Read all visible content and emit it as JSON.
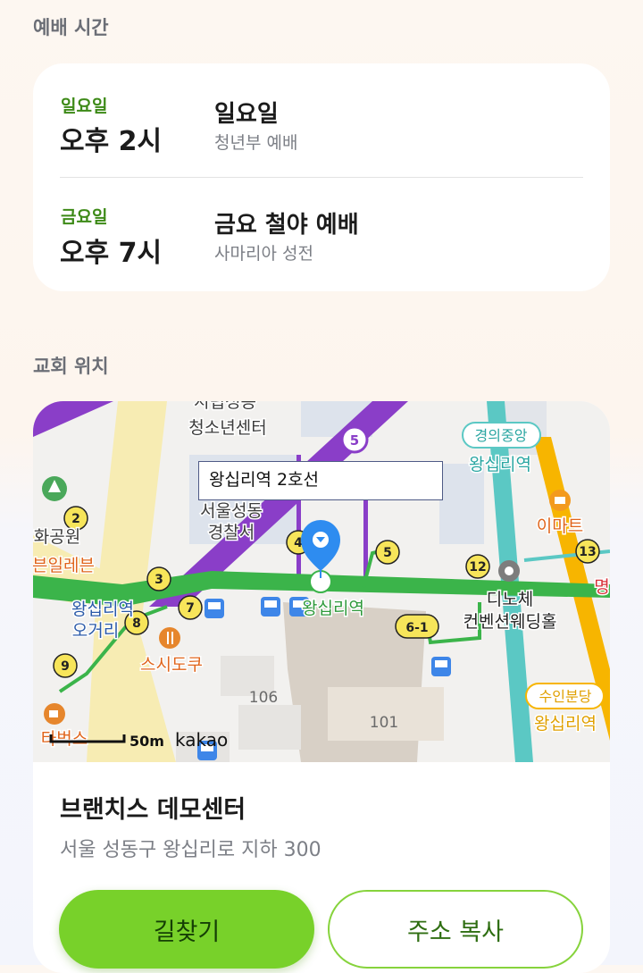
{
  "worship": {
    "section_title": "예배 시간",
    "services": [
      {
        "day": "일요일",
        "time": "오후 2시",
        "name": "일요일",
        "place": "청년부 예배"
      },
      {
        "day": "금요일",
        "time": "오후 7시",
        "name": "금요 철야 예배",
        "place": "사마리아 성전"
      }
    ]
  },
  "location": {
    "section_title": "교회 위치",
    "map": {
      "tooltip": "왕십리역 2호선",
      "labels": {
        "youth_center_1": "시립성동",
        "youth_center_2": "청소년센터",
        "police_1": "서울성동",
        "police_2": "경찰서",
        "gyeongui_badge": "경의중앙",
        "gyeongui_station": "왕십리역",
        "emart": "이마트",
        "park": "화공원",
        "seven_eleven": "븐일레븐",
        "exit_1": "왕십리역",
        "exit_2": "오거리",
        "sushi": "스시도쿠",
        "station_main": "왕십리역",
        "dino_1": "디노체",
        "dino_2": "컨벤션웨딩홀",
        "myeong": "명",
        "suin_badge": "수인분당",
        "suin_station": "왕십리역",
        "bldg_106": "106",
        "bldg_101": "101",
        "starbucks": "타벅스",
        "scale": "50m",
        "brand": "kakao"
      },
      "exits": [
        "2",
        "3",
        "4",
        "5",
        "6-1",
        "7",
        "8",
        "9",
        "12",
        "13"
      ],
      "line5_badge": "5"
    },
    "place_name": "브랜치스 데모센터",
    "address": "서울 성동구 왕십리로 지하 300",
    "directions_button": "길찾기",
    "copy_button": "주소 복사"
  },
  "colors": {
    "accent_green": "#78d12a",
    "line2_green": "#3bb44a",
    "line5_purple": "#8a3ec8",
    "suin_yellow": "#f7b500",
    "gyeongui_teal": "#5bc8c4",
    "marker_blue": "#2e8cf0"
  }
}
